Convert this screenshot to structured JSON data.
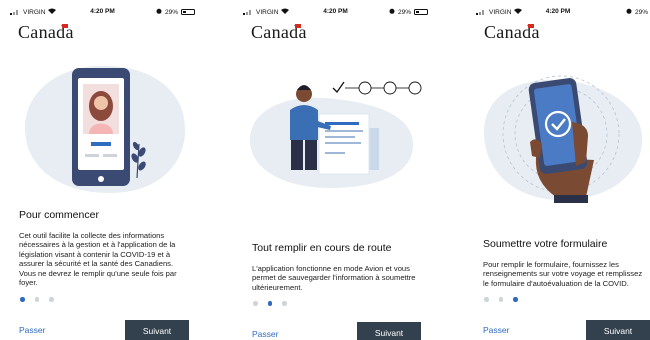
{
  "screens": [
    {
      "status": {
        "carrier": "VIRGIN",
        "time": "4:20 PM",
        "battery": "29%"
      },
      "wordmark": "Canada",
      "title": "Pour commencer",
      "body": "Cet outil facilite la collecte des informations nécessaires à la gestion et à l'application de la législation visant à contenir la COVID-19 et à assurer la sécurité et la santé des Canadiens. Vous ne devrez le remplir qu'une seule fois par foyer.",
      "skip_label": "Passer",
      "next_label": "Suivant",
      "page_indicator": {
        "current": 1,
        "total": 3
      }
    },
    {
      "status": {
        "carrier": "VIRGIN",
        "time": "4:20 PM",
        "battery": "29%"
      },
      "wordmark": "Canada",
      "title": "Tout remplir en cours de route",
      "body": "L'application fonctionne en mode Avion et vous permet de sauvegarder l'information à soumettre ultérieurement.",
      "skip_label": "Passer",
      "next_label": "Suivant",
      "page_indicator": {
        "current": 2,
        "total": 3
      }
    },
    {
      "status": {
        "carrier": "VIRGIN",
        "time": "4:20 PM",
        "battery": "29%"
      },
      "wordmark": "Canada",
      "title": "Soumettre votre formulaire",
      "body": "Pour remplir le formulaire, fournissez les renseignements sur votre voyage et remplissez le formulaire d'autoévaluation de la COVID.",
      "skip_label": "Passer",
      "next_label": "Suivant",
      "page_indicator": {
        "current": 3,
        "total": 3
      }
    }
  ],
  "colors": {
    "accent": "#2f6bbf",
    "button": "#33404d",
    "blob": "#e7edf3",
    "phone": "#3a4a73",
    "dot_inactive": "#cfd4da"
  },
  "icons": [
    "signal-icon",
    "wifi-icon",
    "alarm-icon",
    "battery-icon",
    "canada-flag-icon",
    "check-icon"
  ]
}
